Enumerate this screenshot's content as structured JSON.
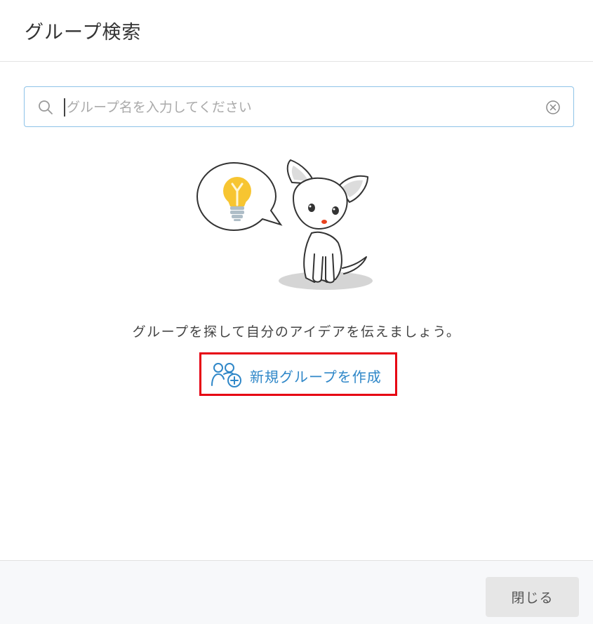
{
  "dialog": {
    "title": "グループ検索"
  },
  "search": {
    "placeholder": "グループ名を入力してください",
    "value": ""
  },
  "empty_state": {
    "message": "グループを探して自分のアイデアを伝えましょう。",
    "create_label": "新規グループを作成",
    "create_icon": "add-group-icon"
  },
  "footer": {
    "close_label": "閉じる"
  },
  "colors": {
    "accent": "#2f87c8",
    "highlight": "#e60012",
    "search_border": "#8ec3e8",
    "footer_bg": "#f7f8fa",
    "button_bg": "#e6e6e6"
  }
}
